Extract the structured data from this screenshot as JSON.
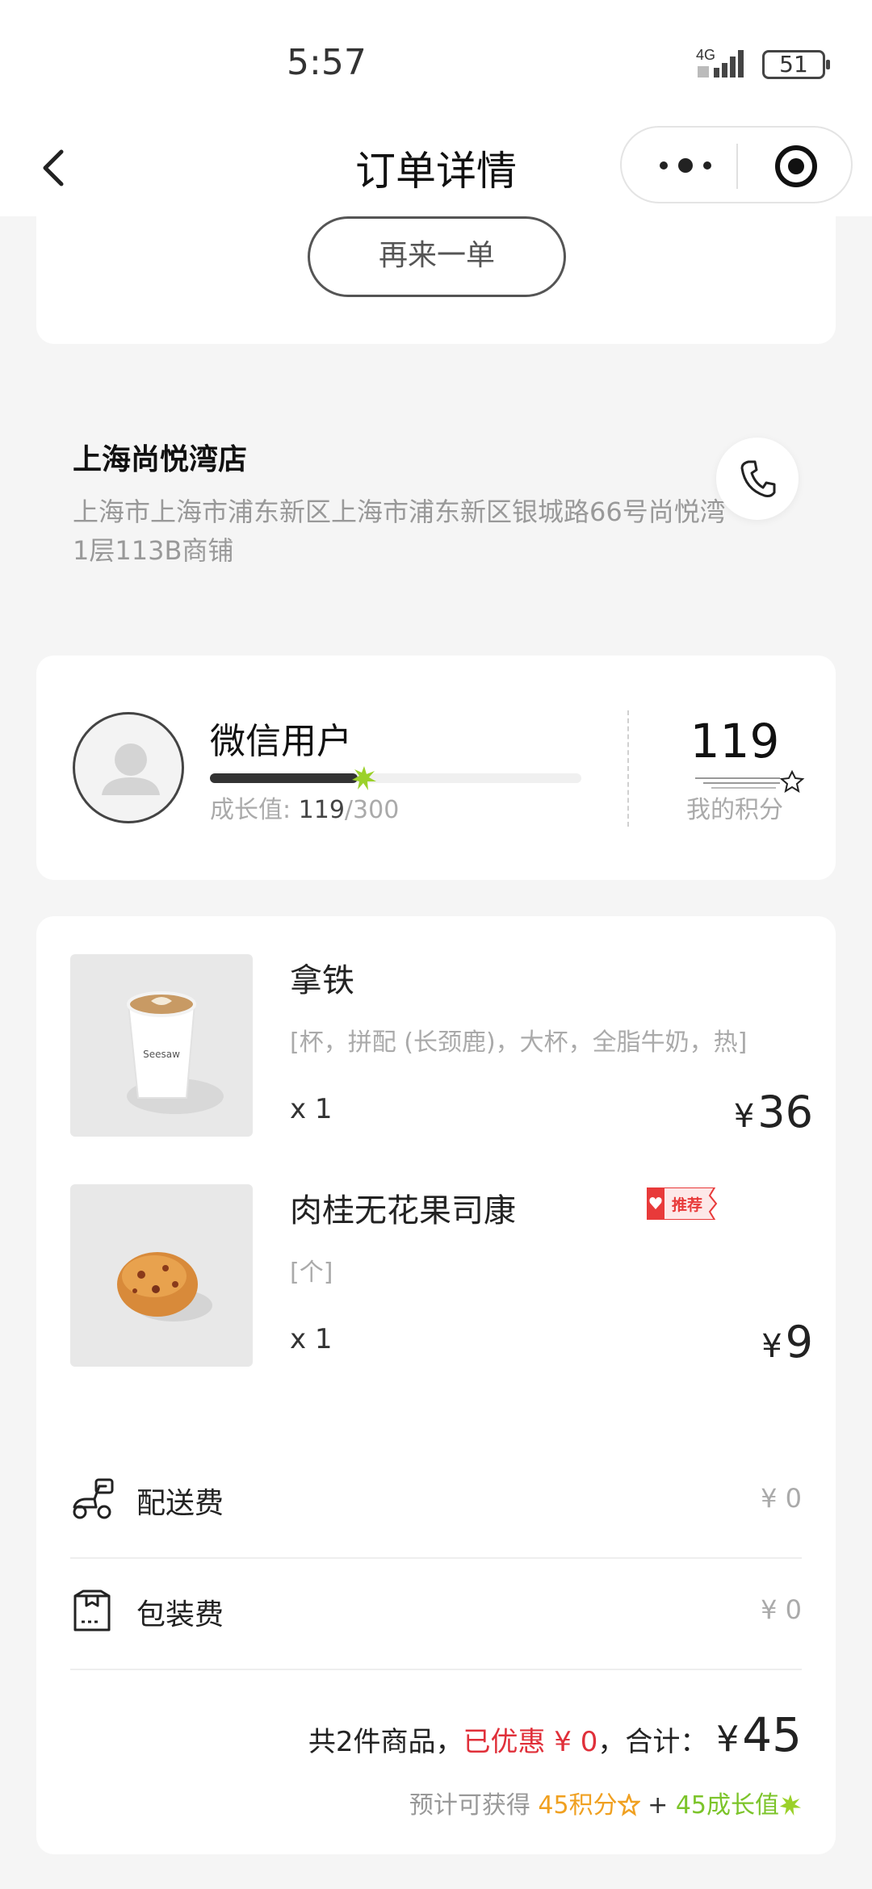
{
  "status_bar": {
    "time": "5:57",
    "network": "4G",
    "battery": "51"
  },
  "nav": {
    "title": "订单详情"
  },
  "top_card": {
    "reorder_label": "再来一单"
  },
  "store": {
    "name": "上海尚悦湾店",
    "address": "上海市上海市浦东新区上海市浦东新区银城路66号尚悦湾1层113B商铺"
  },
  "member": {
    "name": "微信用户",
    "growth_label": "成长值:",
    "growth_current": "119",
    "growth_max": "/300",
    "growth_progress": 0.397,
    "points": "119",
    "points_label": "我的积分"
  },
  "items": [
    {
      "name": "拿铁",
      "spec": "[杯，拼配 (长颈鹿)，大杯，全脂牛奶，热]",
      "qty": "x 1",
      "currency": "¥",
      "price": "36",
      "tag": ""
    },
    {
      "name": "肉桂无花果司康",
      "spec": "[个]",
      "qty": "x 1",
      "currency": "¥",
      "price": "9",
      "tag": "推荐"
    }
  ],
  "fees": [
    {
      "label": "配送费",
      "value": "¥ 0",
      "icon": "scooter-icon"
    },
    {
      "label": "包装费",
      "value": "¥ 0",
      "icon": "package-icon"
    }
  ],
  "summary": {
    "count_text": "共2件商品，",
    "discount_text": "已优惠 ¥ 0",
    "total_label": "，合计：",
    "currency": "¥",
    "total": "45"
  },
  "earn": {
    "prefix": "预计可获得",
    "points": "45积分",
    "plus": "+",
    "growth": "45成长值"
  },
  "colors": {
    "accent_red": "#e0303a",
    "points_gold": "#f0a020",
    "growth_green": "#7cc42a"
  }
}
